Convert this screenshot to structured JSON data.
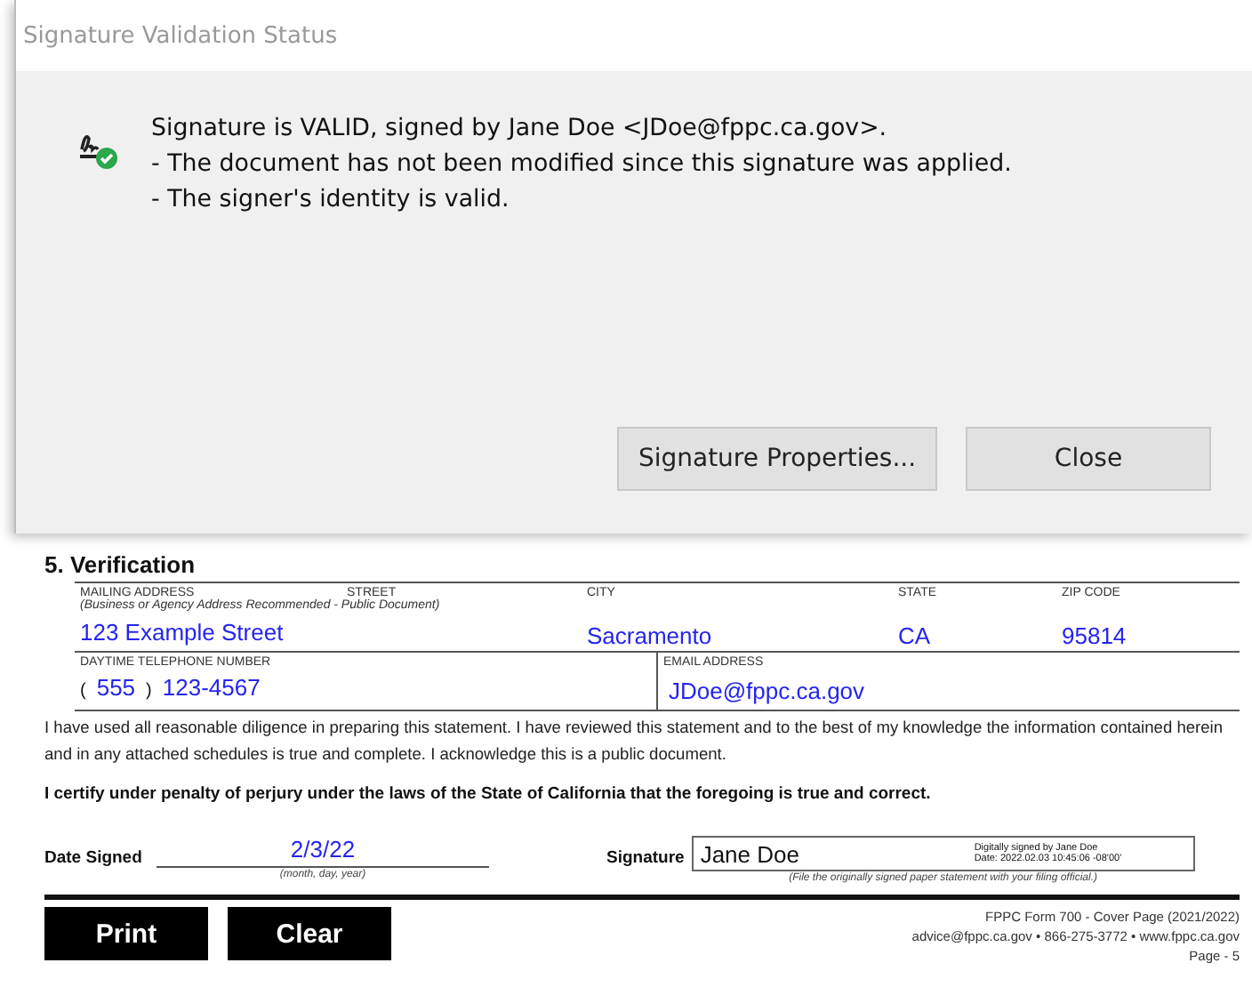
{
  "dialog": {
    "title": "Signature Validation Status",
    "signature_valid": true,
    "lines": [
      "Signature is VALID, signed by Jane Doe <JDoe@fppc.ca.gov>.",
      "- The document has not been modified since this signature was applied.",
      "- The signer's identity is valid."
    ],
    "buttons": [
      "Signature Properties...",
      "Close"
    ]
  },
  "form": {
    "heading": "5. Verification",
    "address_labels": {
      "mailing": "MAILING ADDRESS",
      "street": "STREET",
      "note": "(Business or Agency Address Recommended - Public Document)",
      "city": "CITY",
      "state": "STATE",
      "zip": "ZIP CODE"
    },
    "address": {
      "street": "123 Example Street",
      "city": "Sacramento",
      "state": "CA",
      "zip": "95814"
    },
    "phone_label": "DAYTIME TELEPHONE NUMBER",
    "phone_open": "(",
    "area_code": "555",
    "phone_close": ")",
    "phone": "123-4567",
    "email_label": "EMAIL ADDRESS",
    "email": "JDoe@fppc.ca.gov",
    "statement": "I have used all reasonable diligence in preparing this statement.  I have reviewed this statement and to the best of my knowledge the information contained herein and in any attached schedules is true and complete.  I acknowledge this is a public document.",
    "certification": "I certify under penalty of perjury under the laws of the State of California that the foregoing is true and correct.",
    "date_label": "Date Signed",
    "date": "2/3/22",
    "date_hint": "(month, day, year)",
    "signature_label": "Signature",
    "signature_name": "Jane Doe",
    "signature_digital": [
      "Digitally signed by Jane Doe",
      "Date: 2022.02.03 10:45:06 -08'00'"
    ],
    "signature_hint": "(File the originally signed paper statement with your filing official.)",
    "buttons": [
      "Print",
      "Clear"
    ],
    "footer": [
      "FPPC Form 700 - Cover Page  (2021/2022)",
      "advice@fppc.ca.gov • 866-275-3772 • www.fppc.ca.gov",
      "Page - 5"
    ]
  }
}
